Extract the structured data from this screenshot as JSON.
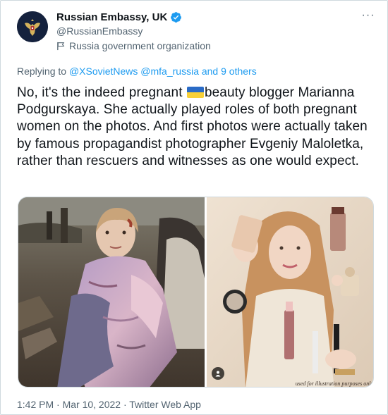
{
  "author": {
    "display_name": "Russian Embassy, UK",
    "handle": "@RussianEmbassy",
    "account_label": "Russia government organization",
    "verified_icon": "verified-badge-icon",
    "avatar_icon": "coat-of-arms-icon"
  },
  "more_menu": {
    "label": "···"
  },
  "reply": {
    "prefix": "Replying to",
    "mentions": "@XSovietNews @mfa_russia and 9 others"
  },
  "text": {
    "before_flag": "No, it's the indeed pregnant ",
    "flag_icon": "ukraine-flag-emoji",
    "after_flag": "beauty blogger Marianna Podgurskaya. She actually played roles of both pregnant women on the photos. And first photos were actually taken by famous propagandist photographer Evgeniy Maloletka, rather than rescuers and witnesses as one would expect."
  },
  "media": {
    "left_photo": "injured-pregnant-woman-photo",
    "right_photo": "beauty-blogger-cosmetics-photo",
    "watermark": "used for illustration purposes only"
  },
  "footer": {
    "timestamp": "1:42 PM · Mar 10, 2022 · Twitter Web App"
  },
  "colors": {
    "link": "#1d9bf0",
    "secondary_text": "#536471",
    "primary_text": "#0f1419",
    "ua_blue": "#2a6bc6",
    "ua_yellow": "#f7d038"
  }
}
